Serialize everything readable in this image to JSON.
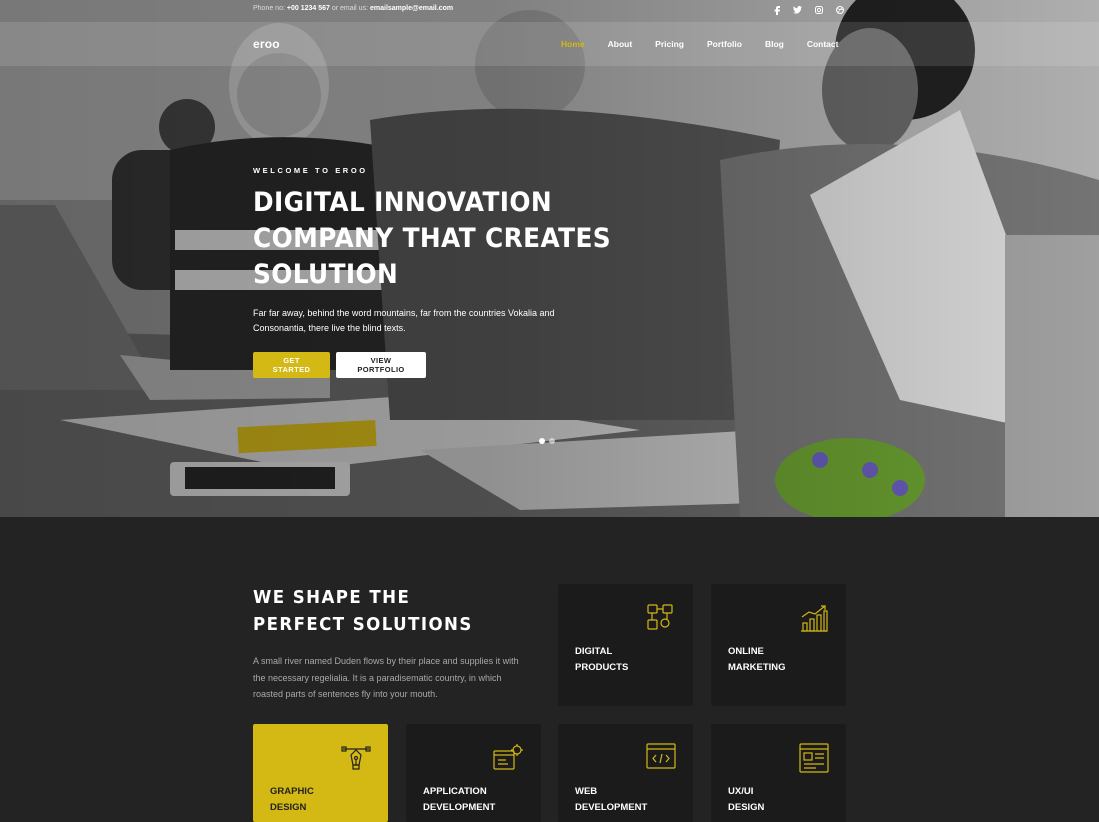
{
  "topbar": {
    "phone_label": "Phone no:",
    "phone": "+00 1234 567",
    "email_label": "or email us:",
    "email": "emailsample@email.com"
  },
  "social_icons": [
    "facebook-icon",
    "twitter-icon",
    "instagram-icon",
    "dribbble-icon"
  ],
  "brand": {
    "logo": "eroo"
  },
  "nav": {
    "items": [
      "Home",
      "About",
      "Pricing",
      "Portfolio",
      "Blog",
      "Contact"
    ],
    "active": "Home"
  },
  "hero": {
    "kicker": "WELCOME TO EROO",
    "headline": "DIGITAL INNOVATION COMPANY THAT CREATES SOLUTION",
    "description": "Far far away, behind the word mountains, far from the countries Vokalia and Consonantia, there live the blind texts.",
    "primary_button": "GET STARTED",
    "secondary_button": "VIEW PORTFOLIO",
    "slides": 2,
    "active_slide": 1
  },
  "services": {
    "title_line1": "WE SHAPE THE",
    "title_line2": "PERFECT SOLUTIONS",
    "description": "A small river named Duden flows by their place and supplies it with the necessary regelialia. It is a paradisematic country, in which roasted parts of sentences fly into your mouth.",
    "cards": [
      {
        "line1": "Digital",
        "line2": "Products",
        "icon": "digital-products-icon"
      },
      {
        "line1": "Online",
        "line2": "Marketing",
        "icon": "growth-chart-icon"
      },
      {
        "line1": "Graphic",
        "line2": "Design",
        "icon": "pen-tool-icon",
        "highlight": true
      },
      {
        "line1": "Application",
        "line2": "Development",
        "icon": "app-settings-icon"
      },
      {
        "line1": "Web",
        "line2": "Development",
        "icon": "code-window-icon"
      },
      {
        "line1": "UX/UI",
        "line2": "Design",
        "icon": "wireframe-icon"
      }
    ]
  },
  "colors": {
    "accent": "#d4b814",
    "dark_bg": "#232323",
    "card_bg": "#1b1b1b"
  }
}
